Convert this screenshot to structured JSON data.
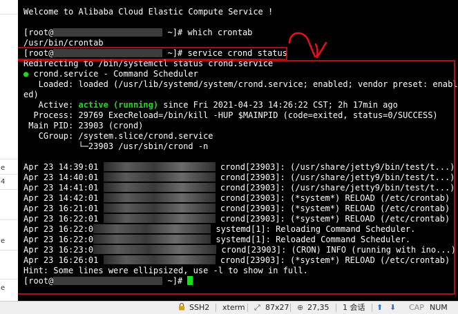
{
  "terminal": {
    "welcome": "Welcome to Alibaba Cloud Elastic Compute Service !",
    "prompt_prefix": "[root@",
    "prompt_suffix": " ~]# ",
    "cmd1": "which crontab",
    "out1": "/usr/bin/crontab",
    "cmd2": "service crond status",
    "redirect": "Redirecting to /bin/systemctl status crond.service",
    "service_title": "crond.service - Command Scheduler",
    "loaded": "   Loaded: loaded (/usr/lib/systemd/system/crond.service; enabled; vendor preset: enabl",
    "loaded_wrap": "ed)",
    "active_label": "   Active: ",
    "active_state": "active (running)",
    "active_since": " since Fri 2021-04-23 14:26:22 CST; 2h 17min ago",
    "process": "  Process: 29769 ExecReload=/bin/kill -HUP $MAINPID (code=exited, status=0/SUCCESS)",
    "main_pid": " Main PID: 23903 (crond)",
    "cgroup": "   CGroup: /system.slice/crond.service",
    "cgroup_child": "           └─23903 /usr/sbin/crond -n",
    "log": [
      {
        "time": "Apr 23 14:39:01",
        "msg": "crond[23903]: (/usr/share/jetty9/bin/test/t...)"
      },
      {
        "time": "Apr 23 14:40:01",
        "msg": "crond[23903]: (/usr/share/jetty9/bin/test/t...)"
      },
      {
        "time": "Apr 23 14:41:01",
        "msg": "crond[23903]: (/usr/share/jetty9/bin/test/t...)"
      },
      {
        "time": "Apr 23 14:42:01",
        "msg": "crond[23903]: (*system*) RELOAD (/etc/crontab)"
      },
      {
        "time": "Apr 23 16:21:01",
        "msg": "crond[23903]: (*system*) RELOAD (/etc/crontab)"
      },
      {
        "time": "Apr 23 16:22:01",
        "msg": "crond[23903]: (*system*) RELOAD (/etc/crontab)"
      },
      {
        "time": "Apr 23 16:22:0",
        "msg": "systemd[1]: Reloading Command Scheduler."
      },
      {
        "time": "Apr 23 16:22:0",
        "msg": "systemd[1]: Reloaded Command Scheduler."
      },
      {
        "time": "Apr 23 16:23:0",
        "msg": "crond[23903]: (CRON) INFO (running with ino...)"
      },
      {
        "time": "Apr 23 16:26:01",
        "msg": "crond[23903]: (*system*) RELOAD (/etc/crontab)"
      }
    ],
    "hint": "Hint: Some lines were ellipsized, use -l to show in full."
  },
  "left_pane": {
    "glyphs": [
      "e",
      "4",
      "e",
      "e"
    ]
  },
  "status_bar": {
    "protocol": "SSH2",
    "terminal_type": "xterm",
    "size": "87x27",
    "cursor_pos": "27,35",
    "sessions": "1 会话",
    "cap": "CAP",
    "num": "NUM"
  },
  "colors": {
    "annotation_red": "#e8121a",
    "running_green": "#22d81f",
    "cursor_green": "#18e018"
  }
}
